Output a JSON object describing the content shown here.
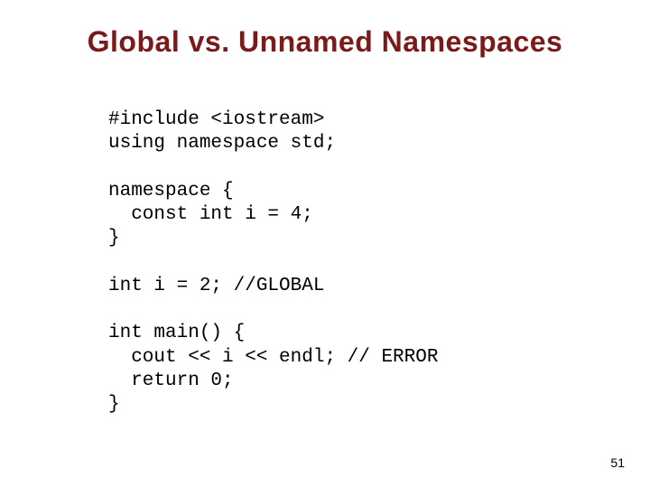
{
  "slide": {
    "title": "Global vs. Unnamed Namespaces",
    "page_number": "51",
    "code": "#include <iostream>\nusing namespace std;\n\nnamespace {\n  const int i = 4;\n}\n\nint i = 2; //GLOBAL\n\nint main() {\n  cout << i << endl; // ERROR\n  return 0;\n}"
  }
}
